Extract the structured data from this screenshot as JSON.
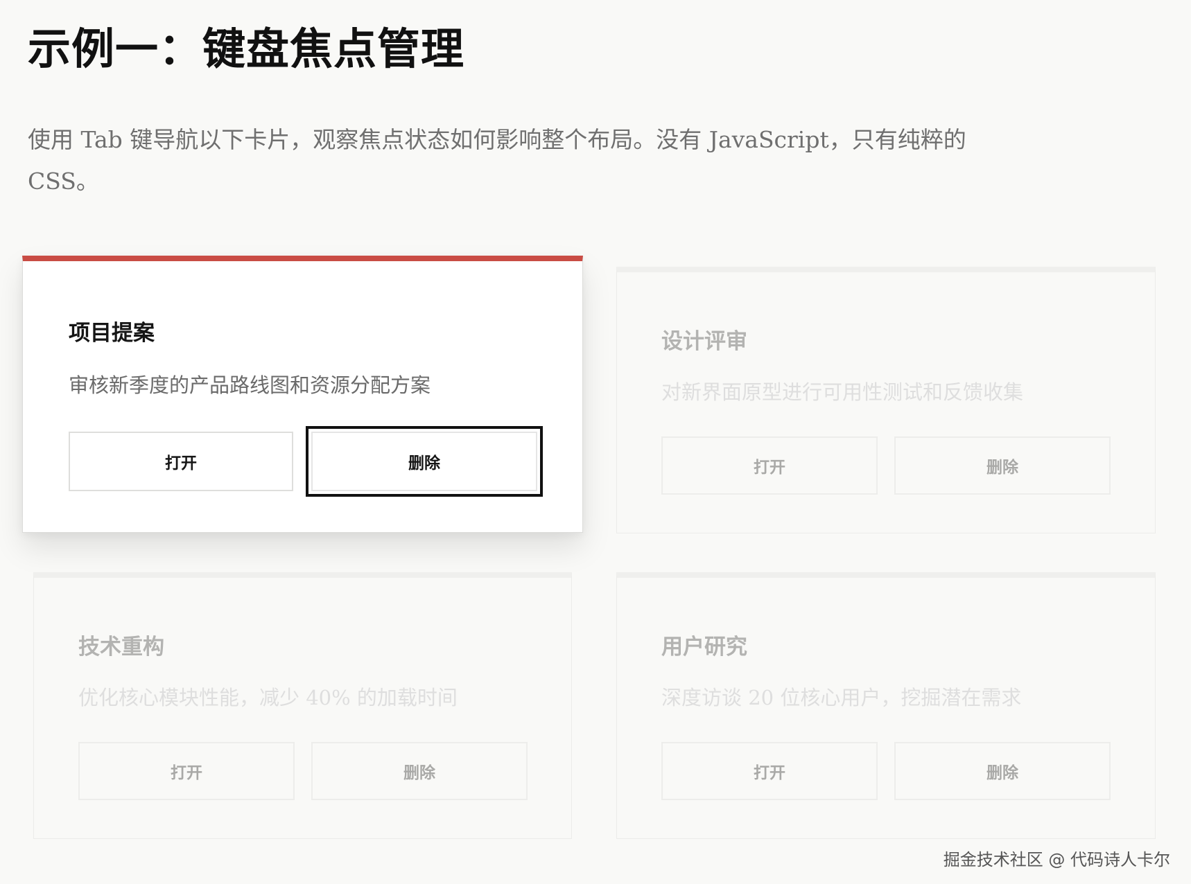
{
  "page": {
    "title": "示例一：键盘焦点管理",
    "intro": "使用 Tab 键导航以下卡片，观察焦点状态如何影响整个布局。没有 JavaScript，只有纯粹的 CSS。"
  },
  "cards": [
    {
      "title": "项目提案",
      "description": "审核新季度的产品路线图和资源分配方案",
      "open_label": "打开",
      "delete_label": "删除",
      "state": "focused"
    },
    {
      "title": "设计评审",
      "description": "对新界面原型进行可用性测试和反馈收集",
      "open_label": "打开",
      "delete_label": "删除",
      "state": "dimmed"
    },
    {
      "title": "技术重构",
      "description": "优化核心模块性能，减少 40% 的加载时间",
      "open_label": "打开",
      "delete_label": "删除",
      "state": "dimmed"
    },
    {
      "title": "用户研究",
      "description": "深度访谈 20 位核心用户，挖掘潜在需求",
      "open_label": "打开",
      "delete_label": "删除",
      "state": "dimmed"
    }
  ],
  "colors": {
    "accent": "#c94c44",
    "background": "#f9f9f7",
    "focus_ring": "#111111"
  },
  "watermark": "掘金技术社区 @ 代码诗人卡尔"
}
